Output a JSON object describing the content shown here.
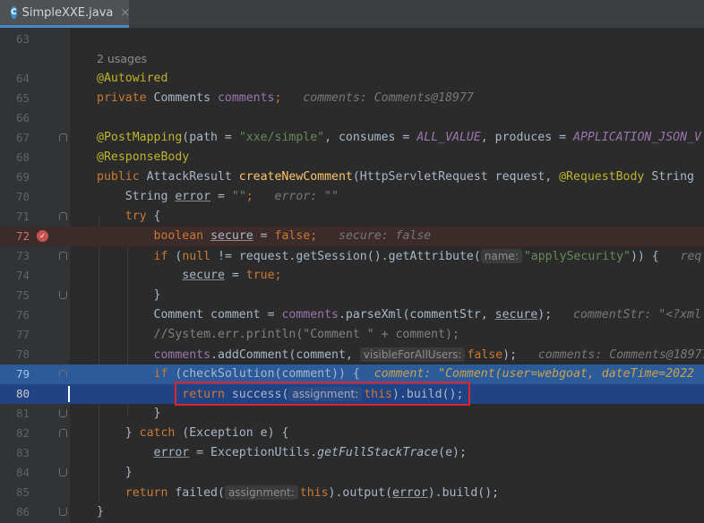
{
  "tab": {
    "title": "SimpleXXE.java",
    "icon_letter": "C",
    "close": "×",
    "icon": "java-class-icon"
  },
  "hint": {
    "usages": "2 usages"
  },
  "colors": {
    "background": "#2b2b2b",
    "keyword": "#cc7832",
    "annotation": "#bbb529",
    "string": "#6a8759",
    "field": "#9876aa",
    "highlight_box": "#e0242c"
  },
  "lines": [
    {
      "n": "63"
    },
    {
      "n": "64",
      "t": [
        "@Autowired"
      ]
    },
    {
      "n": "65",
      "t": [
        "private",
        " Comments ",
        "comments",
        ";",
        "comments: Comments@18977"
      ]
    },
    {
      "n": "66"
    },
    {
      "n": "67",
      "t": [
        "@PostMapping",
        "(path = ",
        "\"xxe/simple\"",
        ", consumes = ",
        "ALL_VALUE",
        ", produces = ",
        "APPLICATION_JSON_V"
      ]
    },
    {
      "n": "68",
      "t": [
        "@ResponseBody"
      ]
    },
    {
      "n": "69",
      "t": [
        "public",
        " AttackResult ",
        "createNewComment",
        "(HttpServletRequest request, ",
        "@RequestBody",
        " String"
      ]
    },
    {
      "n": "70",
      "t": [
        "String ",
        "error",
        " = ",
        "\"\"",
        ";",
        "error: \"\""
      ]
    },
    {
      "n": "71",
      "t": [
        "try",
        " {"
      ]
    },
    {
      "n": "72",
      "t": [
        "boolean",
        " ",
        "secure",
        " = ",
        "false",
        ";",
        "secure: false"
      ]
    },
    {
      "n": "73",
      "t": [
        "if",
        " (",
        "null",
        " != request.getSession().getAttribute(",
        "name:",
        "\"applySecurity\"",
        ")) {",
        "req"
      ]
    },
    {
      "n": "74",
      "t": [
        "secure",
        " = ",
        "true",
        ";"
      ]
    },
    {
      "n": "75",
      "t": [
        "}"
      ]
    },
    {
      "n": "76",
      "t": [
        "Comment comment = ",
        "comments",
        ".parseXml(commentStr, ",
        "secure",
        ");",
        "commentStr: \"<?xml"
      ]
    },
    {
      "n": "77",
      "t": [
        "//System.err.println(\"Comment \" + comment);"
      ]
    },
    {
      "n": "78",
      "t": [
        "comments",
        ".addComment(comment, ",
        "visibleForAllUsers:",
        "false",
        ");",
        "comments: Comments@18977"
      ]
    },
    {
      "n": "79",
      "t": [
        "if",
        " (checkSolution(comment)) {",
        "comment: \"Comment(user=webgoat, dateTime=2022"
      ]
    },
    {
      "n": "80",
      "t": [
        "return",
        " success(",
        "assignment:",
        "this",
        ").build();"
      ]
    },
    {
      "n": "81",
      "t": [
        "}"
      ]
    },
    {
      "n": "82",
      "t": [
        "} ",
        "catch",
        " (Exception e) {"
      ]
    },
    {
      "n": "83",
      "t": [
        "error",
        " = ExceptionUtils.",
        "getFullStackTrace",
        "(e);"
      ]
    },
    {
      "n": "84",
      "t": [
        "}"
      ]
    },
    {
      "n": "85",
      "t": [
        "return",
        " failed(",
        "assignment:",
        "this",
        ").output(",
        "error",
        ").build();"
      ]
    },
    {
      "n": "86",
      "t": [
        "}"
      ]
    }
  ]
}
